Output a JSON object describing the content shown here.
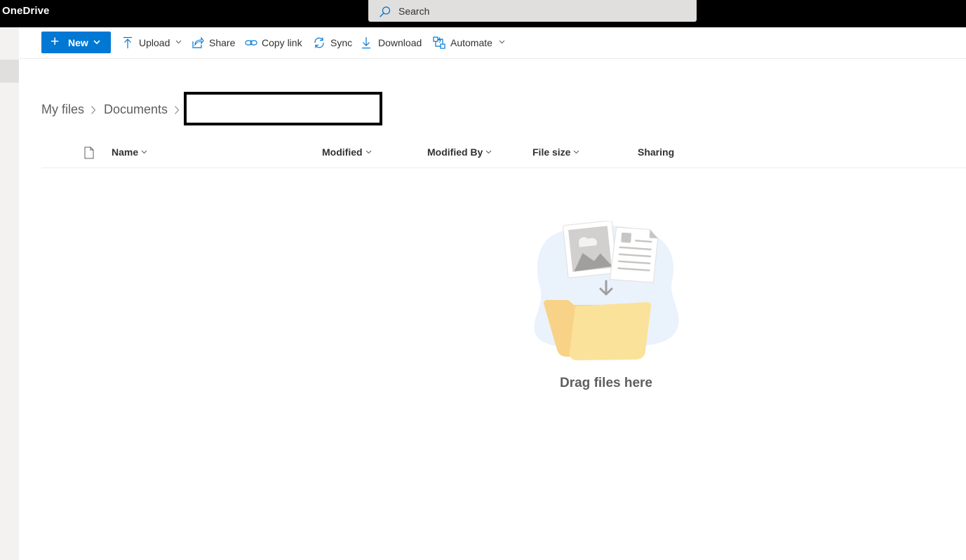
{
  "app": {
    "title": "OneDrive"
  },
  "search": {
    "placeholder": "Search"
  },
  "toolbar": {
    "new_label": "New",
    "items": [
      {
        "label": "Upload",
        "icon": "upload-icon",
        "has_dropdown": true
      },
      {
        "label": "Share",
        "icon": "share-icon",
        "has_dropdown": false
      },
      {
        "label": "Copy link",
        "icon": "link-icon",
        "has_dropdown": false
      },
      {
        "label": "Sync",
        "icon": "sync-icon",
        "has_dropdown": false
      },
      {
        "label": "Download",
        "icon": "download-icon",
        "has_dropdown": false
      },
      {
        "label": "Automate",
        "icon": "automate-icon",
        "has_dropdown": true
      }
    ]
  },
  "breadcrumb": {
    "items": [
      "My files",
      "Documents"
    ],
    "current": ""
  },
  "table": {
    "columns": [
      {
        "label": "Name",
        "sortable": true
      },
      {
        "label": "Modified",
        "sortable": true
      },
      {
        "label": "Modified By",
        "sortable": true
      },
      {
        "label": "File size",
        "sortable": true
      },
      {
        "label": "Sharing",
        "sortable": false
      }
    ],
    "rows": []
  },
  "empty_state": {
    "message": "Drag files here"
  },
  "colors": {
    "suitebar": "#000000",
    "accent": "#0078d4",
    "folder_back": "#f8d387",
    "folder_front": "#fbe29a",
    "blob": "#eaf2fc"
  }
}
